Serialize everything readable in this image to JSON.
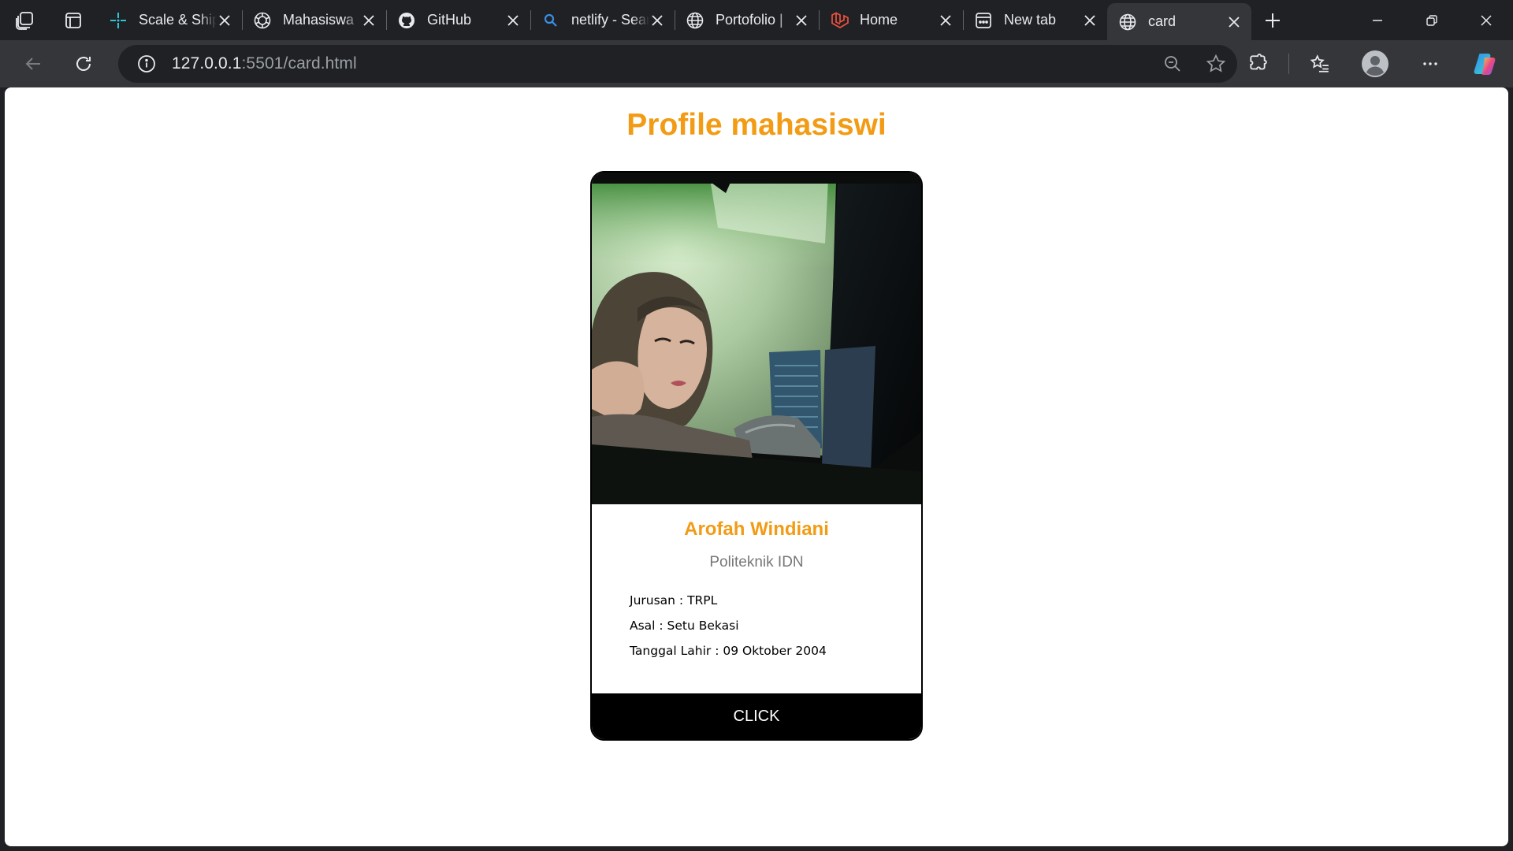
{
  "browser": {
    "tabs": [
      {
        "title": "Scale & Ship",
        "icon": "sparkle-icon"
      },
      {
        "title": "Mahasiswa",
        "icon": "openai-icon"
      },
      {
        "title": "GitHub",
        "icon": "github-icon"
      },
      {
        "title": "netlify - Search",
        "icon": "search-icon"
      },
      {
        "title": "Portofolio |",
        "icon": "globe-icon"
      },
      {
        "title": "Home",
        "icon": "laravel-icon"
      },
      {
        "title": "New tab",
        "icon": "newtab-icon"
      },
      {
        "title": "card",
        "icon": "globe-icon"
      }
    ],
    "active_tab_index": 7,
    "url_host": "127.0.0.1",
    "url_path": ":5501/card.html",
    "accent_orange": "#f29b14"
  },
  "page": {
    "title": "Profile mahasiswi",
    "card": {
      "name": "Arofah Windiani",
      "school": "Politeknik IDN",
      "jurusan": "Jurusan : TRPL",
      "asal": "Asal : Setu Bekasi",
      "tanggal_lahir": "Tanggal Lahir : 09 Oktober 2004",
      "button_label": "CLICK"
    }
  }
}
